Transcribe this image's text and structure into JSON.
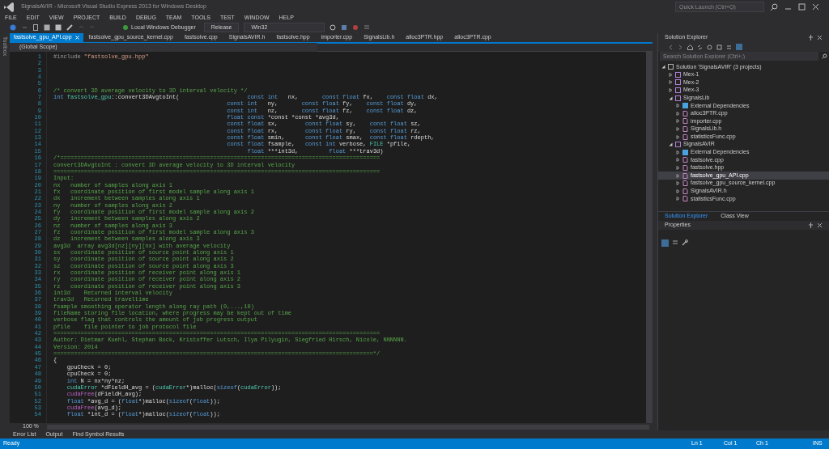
{
  "window": {
    "title": "SignalsAVIR - Microsoft Visual Studio Express 2013 for Windows Desktop",
    "quick_launch": {
      "placeholder": "Quick Launch (Ctrl+Q)"
    }
  },
  "menu": [
    "FILE",
    "EDIT",
    "VIEW",
    "PROJECT",
    "BUILD",
    "DEBUG",
    "TEAM",
    "TOOLS",
    "TEST",
    "WINDOW",
    "HELP"
  ],
  "toolbar": {
    "debugger": "Local Windows Debugger",
    "configuration": "Release",
    "platform": "Win32"
  },
  "side_tab": "Toolbox",
  "document_tabs": [
    {
      "label": "fastsolve_gpu_API.cpp",
      "selected": true
    },
    {
      "label": "fastsolve_gpu_source_kernel.cpp",
      "selected": false
    },
    {
      "label": "fastsolve.cpp",
      "selected": false
    },
    {
      "label": "SignalsAVIR.h",
      "selected": false
    },
    {
      "label": "fastsolve.hpp",
      "selected": false
    },
    {
      "label": "importer.cpp",
      "selected": false
    },
    {
      "label": "SignalsLib.h",
      "selected": false
    },
    {
      "label": "alloc3PTR.hpp",
      "selected": false
    },
    {
      "label": "alloc3PTR.cpp",
      "selected": false
    }
  ],
  "scope": "(Global Scope)",
  "code_lines": [
    {
      "number": "1",
      "segments": [
        {
          "kind": "preprocessor",
          "text": "#include "
        },
        {
          "kind": "string",
          "text": "\"fastsolve_gpu.hpp\""
        }
      ]
    },
    {
      "number": "2"
    },
    {
      "number": "3"
    },
    {
      "number": "4"
    },
    {
      "number": "5"
    },
    {
      "number": "6",
      "segments": [
        {
          "kind": "comment",
          "text": "/* convert 3D average velocity to 3D interval velocity */"
        }
      ]
    },
    {
      "number": "7",
      "segments": [
        {
          "kind": "keyword",
          "text": "int "
        },
        {
          "kind": "type",
          "text": "fastsolve_gpu"
        },
        {
          "kind": "plain",
          "text": "::convert3DAvgtoInt("
        },
        {
          "kind": "keyword",
          "text": "                    const int   "
        },
        {
          "kind": "plain",
          "text": "nx,       "
        },
        {
          "kind": "keyword",
          "text": "const float "
        },
        {
          "kind": "plain",
          "text": "fx,    "
        },
        {
          "kind": "keyword",
          "text": "const float "
        },
        {
          "kind": "plain",
          "text": "dx,"
        }
      ]
    },
    {
      "number": "8",
      "segments": [
        {
          "kind": "keyword",
          "text": "                                                   const int   "
        },
        {
          "kind": "plain",
          "text": "ny,       "
        },
        {
          "kind": "keyword",
          "text": "const float "
        },
        {
          "kind": "plain",
          "text": "fy,    "
        },
        {
          "kind": "keyword",
          "text": "const float "
        },
        {
          "kind": "plain",
          "text": "dy,"
        }
      ]
    },
    {
      "number": "9",
      "segments": [
        {
          "kind": "keyword",
          "text": "                                                   const int   "
        },
        {
          "kind": "plain",
          "text": "nz,       "
        },
        {
          "kind": "keyword",
          "text": "const float "
        },
        {
          "kind": "plain",
          "text": "fz,    "
        },
        {
          "kind": "keyword",
          "text": "const float "
        },
        {
          "kind": "plain",
          "text": "dz,"
        }
      ]
    },
    {
      "number": "10",
      "segments": [
        {
          "kind": "keyword",
          "text": "                                                   float const "
        },
        {
          "kind": "plain",
          "text": "*const *const *avg3d,"
        }
      ]
    },
    {
      "number": "11",
      "segments": [
        {
          "kind": "keyword",
          "text": "                                                   const float "
        },
        {
          "kind": "plain",
          "text": "sx,        "
        },
        {
          "kind": "keyword",
          "text": "const float "
        },
        {
          "kind": "plain",
          "text": "sy,    "
        },
        {
          "kind": "keyword",
          "text": "const float "
        },
        {
          "kind": "plain",
          "text": "sz,"
        }
      ]
    },
    {
      "number": "12",
      "segments": [
        {
          "kind": "keyword",
          "text": "                                                   const float "
        },
        {
          "kind": "plain",
          "text": "rx,        "
        },
        {
          "kind": "keyword",
          "text": "const float "
        },
        {
          "kind": "plain",
          "text": "ry,    "
        },
        {
          "kind": "keyword",
          "text": "const float "
        },
        {
          "kind": "plain",
          "text": "rz,"
        }
      ]
    },
    {
      "number": "13",
      "segments": [
        {
          "kind": "keyword",
          "text": "                                                   const float "
        },
        {
          "kind": "plain",
          "text": "smin,      "
        },
        {
          "kind": "keyword",
          "text": "const float "
        },
        {
          "kind": "plain",
          "text": "smax,  "
        },
        {
          "kind": "keyword",
          "text": "const float "
        },
        {
          "kind": "plain",
          "text": "rdepth,"
        }
      ]
    },
    {
      "number": "14",
      "segments": [
        {
          "kind": "keyword",
          "text": "                                                   const float "
        },
        {
          "kind": "plain",
          "text": "fsample,   "
        },
        {
          "kind": "keyword",
          "text": "const int "
        },
        {
          "kind": "plain",
          "text": "verbose, "
        },
        {
          "kind": "type",
          "text": "FILE "
        },
        {
          "kind": "plain",
          "text": "*pfile,"
        }
      ]
    },
    {
      "number": "15",
      "segments": [
        {
          "kind": "keyword",
          "text": "                                                         float "
        },
        {
          "kind": "plain",
          "text": "***int3d,         "
        },
        {
          "kind": "keyword",
          "text": "float "
        },
        {
          "kind": "plain",
          "text": "***trav3d)"
        }
      ]
    },
    {
      "number": "16",
      "segments": [
        {
          "kind": "comment",
          "text": "/*=============================================================================================="
        }
      ]
    },
    {
      "number": "17",
      "segments": [
        {
          "kind": "comment",
          "text": "convert3DAvgtoInt : convert 3D average velocity to 3D interval velocity"
        }
      ]
    },
    {
      "number": "18",
      "segments": [
        {
          "kind": "comment",
          "text": "================================================================================================"
        }
      ]
    },
    {
      "number": "19",
      "segments": [
        {
          "kind": "comment",
          "text": "Input:"
        }
      ]
    },
    {
      "number": "20",
      "segments": [
        {
          "kind": "comment",
          "text": "nx   number of samples along axis 1"
        }
      ]
    },
    {
      "number": "21",
      "segments": [
        {
          "kind": "comment",
          "text": "fx   coordinate position of first model sample along axis 1"
        }
      ]
    },
    {
      "number": "22",
      "segments": [
        {
          "kind": "comment",
          "text": "dx   increment between samples along axis 1"
        }
      ]
    },
    {
      "number": "23",
      "segments": [
        {
          "kind": "comment",
          "text": "ny   number of samples along axis 2"
        }
      ]
    },
    {
      "number": "24",
      "segments": [
        {
          "kind": "comment",
          "text": "fy   coordinate position of first model sample along axis 2"
        }
      ]
    },
    {
      "number": "25",
      "segments": [
        {
          "kind": "comment",
          "text": "dy   increment between samples along axis 2"
        }
      ]
    },
    {
      "number": "26",
      "segments": [
        {
          "kind": "comment",
          "text": "nz   number of samples along axis 3"
        }
      ]
    },
    {
      "number": "27",
      "segments": [
        {
          "kind": "comment",
          "text": "fz   coordinate position of first model sample along axis 3"
        }
      ]
    },
    {
      "number": "28",
      "segments": [
        {
          "kind": "comment",
          "text": "dz   increment between samples along axis 3"
        }
      ]
    },
    {
      "number": "29",
      "segments": [
        {
          "kind": "comment",
          "text": "avg3d  array avg3d[nz][ny][nx] with average velocity"
        }
      ]
    },
    {
      "number": "30",
      "segments": [
        {
          "kind": "comment",
          "text": "sx   coordinate position of source point along axis 1"
        }
      ]
    },
    {
      "number": "31",
      "segments": [
        {
          "kind": "comment",
          "text": "sy   coordinate position of source point along axis 2"
        }
      ]
    },
    {
      "number": "32",
      "segments": [
        {
          "kind": "comment",
          "text": "sz   coordinate position of source point along axis 3"
        }
      ]
    },
    {
      "number": "33",
      "segments": [
        {
          "kind": "comment",
          "text": "rx   coordinate position of receiver point along axis 1"
        }
      ]
    },
    {
      "number": "34",
      "segments": [
        {
          "kind": "comment",
          "text": "ry   coordinate position of receiver point along axis 2"
        }
      ]
    },
    {
      "number": "35",
      "segments": [
        {
          "kind": "comment",
          "text": "rz   coordinate position of receiver point along axis 3"
        }
      ]
    },
    {
      "number": "36",
      "segments": [
        {
          "kind": "comment",
          "text": "int3d    Returned interval velocity"
        }
      ]
    },
    {
      "number": "37",
      "segments": [
        {
          "kind": "comment",
          "text": "trav3d   Returned traveltime"
        }
      ]
    },
    {
      "number": "38",
      "segments": [
        {
          "kind": "comment",
          "text": "fsample smoothing operator length along ray path (0,...,10)"
        }
      ]
    },
    {
      "number": "39",
      "segments": [
        {
          "kind": "comment",
          "text": "fileName storing file location, where progress may be kept out of time"
        }
      ]
    },
    {
      "number": "40",
      "segments": [
        {
          "kind": "comment",
          "text": "verbose flag that controls the amount of job progress output"
        }
      ]
    },
    {
      "number": "41",
      "segments": [
        {
          "kind": "comment",
          "text": "pfile    file pointer to job protocol file"
        }
      ]
    },
    {
      "number": "42",
      "segments": [
        {
          "kind": "comment",
          "text": "================================================================================================"
        }
      ]
    },
    {
      "number": "43",
      "segments": [
        {
          "kind": "comment",
          "text": "Author: Dietmar Kuehl, Stephan Bock, Kristoffer Lutsch, Ilya Pilyugin, Siegfried Hirsch, Nicole, NNNNNN."
        }
      ]
    },
    {
      "number": "44",
      "segments": [
        {
          "kind": "comment",
          "text": "Version: 2014"
        }
      ]
    },
    {
      "number": "45",
      "segments": [
        {
          "kind": "comment",
          "text": "==============================================================================================*/"
        }
      ]
    },
    {
      "number": "46",
      "segments": [
        {
          "kind": "plain",
          "text": "{"
        }
      ]
    },
    {
      "number": "47",
      "segments": [
        {
          "kind": "plain",
          "text": "    gpuCheck = 0;"
        }
      ]
    },
    {
      "number": "48",
      "segments": [
        {
          "kind": "plain",
          "text": "    cpuCheck = 0;"
        }
      ]
    },
    {
      "number": "49",
      "segments": [
        {
          "kind": "keyword",
          "text": "    int "
        },
        {
          "kind": "plain",
          "text": "N = nx*ny*nz;"
        }
      ]
    },
    {
      "number": "50",
      "segments": [
        {
          "kind": "type",
          "text": "    cudaError "
        },
        {
          "kind": "plain",
          "text": "*dFieldH_avg = ("
        },
        {
          "kind": "type",
          "text": "cudaError"
        },
        {
          "kind": "plain",
          "text": "*)malloc("
        },
        {
          "kind": "keyword",
          "text": "sizeof"
        },
        {
          "kind": "plain",
          "text": "("
        },
        {
          "kind": "type",
          "text": "cudaError"
        },
        {
          "kind": "plain",
          "text": "));"
        }
      ]
    },
    {
      "number": "51",
      "segments": [
        {
          "kind": "macro",
          "text": "    cudaFree"
        },
        {
          "kind": "plain",
          "text": "(dFieldH_avg);"
        }
      ]
    },
    {
      "number": "52",
      "segments": [
        {
          "kind": "keyword",
          "text": "    float "
        },
        {
          "kind": "plain",
          "text": "*avg_d = ("
        },
        {
          "kind": "keyword",
          "text": "float"
        },
        {
          "kind": "plain",
          "text": "*)malloc("
        },
        {
          "kind": "keyword",
          "text": "sizeof"
        },
        {
          "kind": "plain",
          "text": "("
        },
        {
          "kind": "keyword",
          "text": "float"
        },
        {
          "kind": "plain",
          "text": "));"
        }
      ]
    },
    {
      "number": "53",
      "segments": [
        {
          "kind": "macro",
          "text": "    cudaFree"
        },
        {
          "kind": "plain",
          "text": "(avg_d);"
        }
      ]
    },
    {
      "number": "54",
      "segments": [
        {
          "kind": "keyword",
          "text": "    float "
        },
        {
          "kind": "plain",
          "text": "*int_d = ("
        },
        {
          "kind": "keyword",
          "text": "float"
        },
        {
          "kind": "plain",
          "text": "*)malloc("
        },
        {
          "kind": "keyword",
          "text": "sizeof"
        },
        {
          "kind": "plain",
          "text": "("
        },
        {
          "kind": "keyword",
          "text": "float"
        },
        {
          "kind": "plain",
          "text": "));"
        }
      ]
    }
  ],
  "zoom": "100 %",
  "solution_explorer": {
    "title": "Solution Explorer",
    "search": {
      "placeholder": "Search Solution Explorer (Ctrl+;)"
    },
    "tree": [
      {
        "label": "Solution 'SignalsAVIR' (3 projects)",
        "kind": "solution",
        "expanded": true,
        "selected": false,
        "children": [
          {
            "label": "Mex-1",
            "kind": "project",
            "expanded": false,
            "selected": false
          },
          {
            "label": "Mex-2",
            "kind": "project",
            "expanded": false,
            "selected": false
          },
          {
            "label": "Mex-3",
            "kind": "project",
            "expanded": false,
            "selected": false
          },
          {
            "label": "SignalsLib",
            "kind": "project",
            "expanded": true,
            "selected": false,
            "children": [
              {
                "label": "External Dependencies",
                "kind": "folder",
                "expanded": false,
                "selected": false
              },
              {
                "label": "alloc3PTR.cpp",
                "kind": "file",
                "expanded": false,
                "selected": false
              },
              {
                "label": "importer.cpp",
                "kind": "file",
                "expanded": false,
                "selected": false
              },
              {
                "label": "SignalsLib.h",
                "kind": "file",
                "expanded": false,
                "selected": false
              },
              {
                "label": "statisticsFunc.cpp",
                "kind": "file",
                "expanded": false,
                "selected": false
              }
            ]
          },
          {
            "label": "SignalsAVIR",
            "kind": "project",
            "expanded": true,
            "selected": false,
            "children": [
              {
                "label": "External Dependencies",
                "kind": "folder",
                "expanded": false,
                "selected": false
              },
              {
                "label": "fastsolve.cpp",
                "kind": "file",
                "expanded": false,
                "selected": false
              },
              {
                "label": "fastsolve.hpp",
                "kind": "file",
                "expanded": false,
                "selected": false
              },
              {
                "label": "fastsolve_gpu_API.cpp",
                "kind": "file",
                "expanded": false,
                "selected": true
              },
              {
                "label": "fastsolve_gpu_source_kernel.cpp",
                "kind": "file",
                "expanded": false,
                "selected": false
              },
              {
                "label": "SignalsAVIR.h",
                "kind": "file",
                "expanded": false,
                "selected": false
              },
              {
                "label": "statisticsFunc.cpp",
                "kind": "file",
                "expanded": false,
                "selected": false
              }
            ]
          }
        ]
      }
    ]
  },
  "panel_tabs": [
    {
      "label": "Solution Explorer",
      "selected": true
    },
    {
      "label": "Class View",
      "selected": false
    }
  ],
  "properties": {
    "title": "Properties"
  },
  "output_tabs": [
    {
      "label": "Error List",
      "selected": false
    },
    {
      "label": "Output",
      "selected": false
    },
    {
      "label": "Find Symbol Results",
      "selected": false
    }
  ],
  "status_bar": {
    "message": "Ready",
    "line": "Ln 1",
    "column": "Col 1",
    "char": "Ch 1",
    "mode": "INS"
  }
}
